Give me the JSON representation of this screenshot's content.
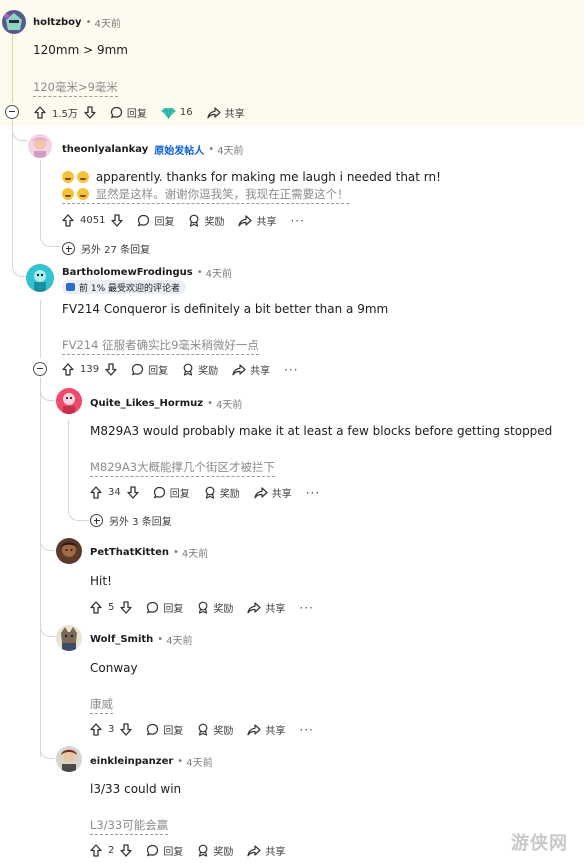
{
  "comments": [
    {
      "user": "holtzboy",
      "time": "4天前",
      "body": "120mm > 9mm",
      "translation": "120毫米>9毫米",
      "votes": "1.5万",
      "reply": "回复",
      "award_count": "16",
      "share": "共享"
    },
    {
      "user": "theonlyalankay",
      "op_tag": "原始发帖人",
      "time": "4天前",
      "body": "apparently. thanks for making me laugh i needed that rn!",
      "translation": "显然是这样。谢谢你逗我笑，我现在正需要这个！",
      "votes": "4051",
      "reply": "回复",
      "award": "奖励",
      "share": "共享",
      "more_replies": "另外 27 条回复"
    },
    {
      "user": "BartholomewFrodingus",
      "time": "4天前",
      "badge": "前 1% 最受欢迎的评论者",
      "body": "FV214 Conqueror is definitely a bit better than a 9mm",
      "translation": "FV214 征服者确实比9毫米稍微好一点",
      "votes": "139",
      "reply": "回复",
      "award": "奖励",
      "share": "共享"
    },
    {
      "user": "Quite_Likes_Hormuz",
      "time": "4天前",
      "body": "M829A3 would probably make it at least a few blocks before getting stopped",
      "translation": "M829A3大概能撑几个街区才被拦下",
      "votes": "34",
      "reply": "回复",
      "award": "奖励",
      "share": "共享",
      "more_replies": "另外 3 条回复"
    },
    {
      "user": "PetThatKitten",
      "time": "4天前",
      "body": "Hit!",
      "votes": "5",
      "reply": "回复",
      "award": "奖励",
      "share": "共享"
    },
    {
      "user": "Wolf_Smith",
      "time": "4天前",
      "body": "Conway",
      "translation": "康威",
      "votes": "3",
      "reply": "回复",
      "award": "奖励",
      "share": "共享"
    },
    {
      "user": "einkleinpanzer",
      "time": "4天前",
      "body": "l3/33 could win",
      "translation": "L3/33可能会赢",
      "votes": "2",
      "reply": "回复",
      "award": "奖励",
      "share": "共享"
    }
  ],
  "watermark": "游侠网",
  "colors": {
    "highlight": "#fdfaf0",
    "op_tag": "#0a5fd8",
    "translation": "#8a8c8e"
  }
}
